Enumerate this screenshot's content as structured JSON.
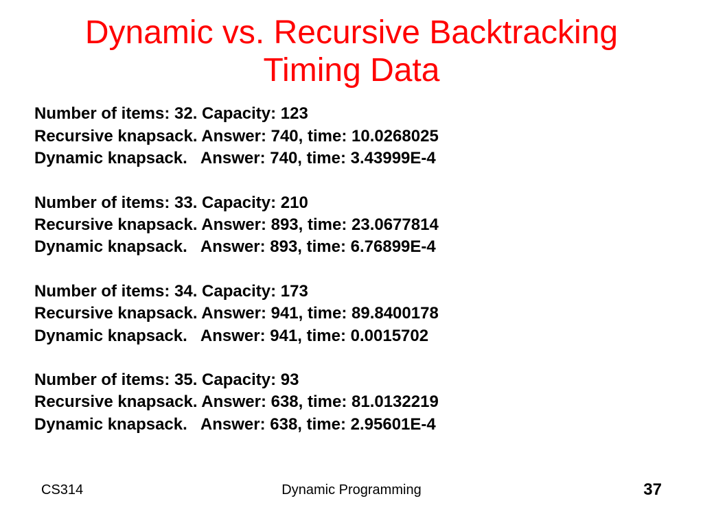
{
  "title": "Dynamic vs. Recursive Backtracking Timing Data",
  "blocks": [
    {
      "header": "Number of items: 32. Capacity: 123",
      "recursive": "Recursive knapsack. Answer: 740, time: 10.0268025",
      "dynamic": "Dynamic knapsack.   Answer: 740, time: 3.43999E-4"
    },
    {
      "header": "Number of items: 33. Capacity: 210",
      "recursive": "Recursive knapsack. Answer: 893, time: 23.0677814",
      "dynamic": "Dynamic knapsack.   Answer: 893, time: 6.76899E-4"
    },
    {
      "header": "Number of items: 34. Capacity: 173",
      "recursive": "Recursive knapsack. Answer: 941, time: 89.8400178",
      "dynamic": "Dynamic knapsack.   Answer: 941, time: 0.0015702"
    },
    {
      "header": "Number of items: 35. Capacity: 93",
      "recursive": "Recursive knapsack. Answer: 638, time: 81.0132219",
      "dynamic": "Dynamic knapsack.   Answer: 638, time: 2.95601E-4"
    }
  ],
  "footer": {
    "left": "CS314",
    "center": "Dynamic Programming",
    "right": "37"
  }
}
